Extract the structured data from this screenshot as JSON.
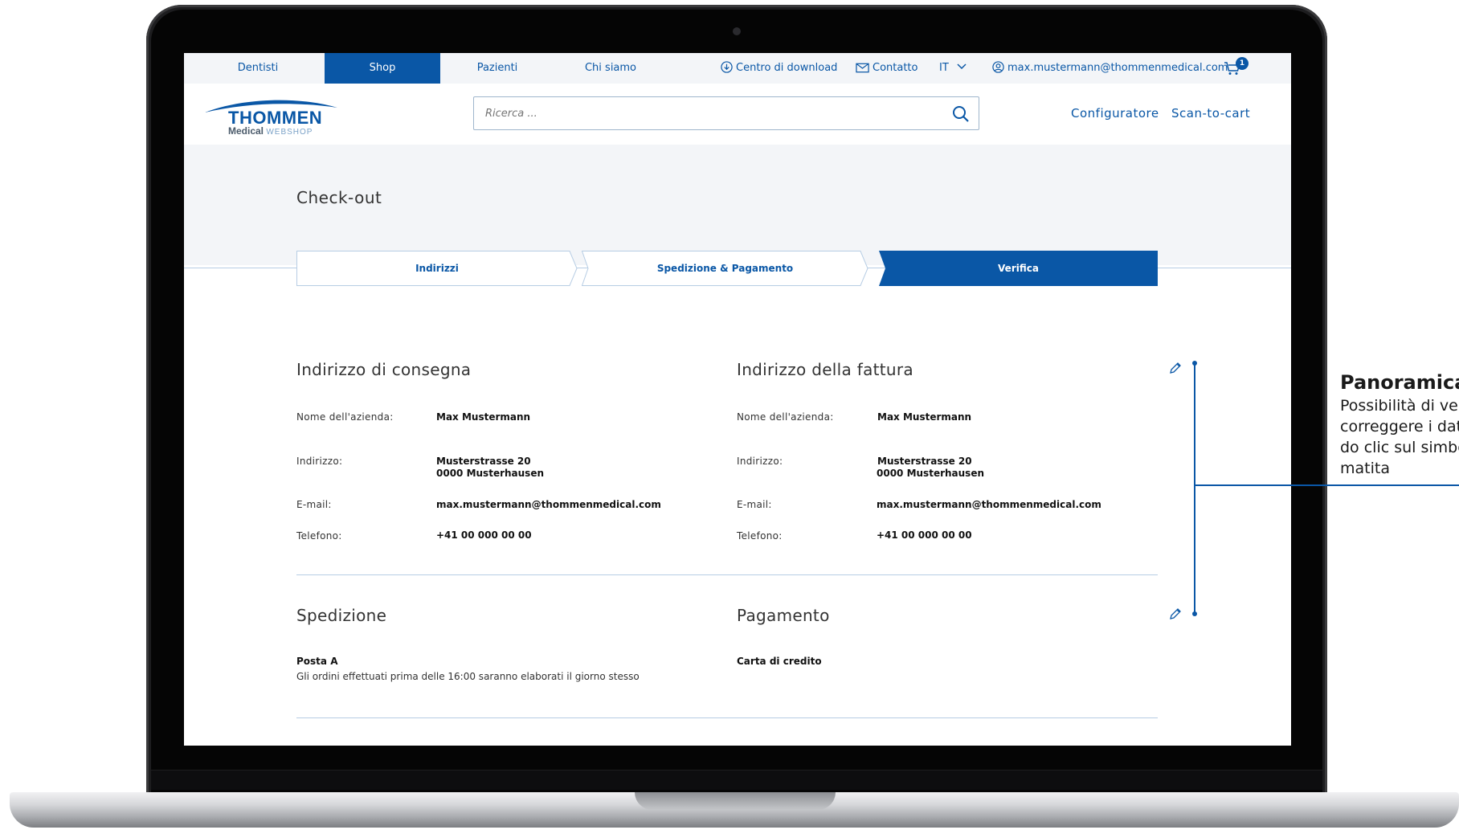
{
  "topnav": {
    "items": [
      {
        "label": "Dentisti",
        "active": false
      },
      {
        "label": "Shop",
        "active": true
      },
      {
        "label": "Pazienti",
        "active": false
      },
      {
        "label": "Chi siamo",
        "active": false
      }
    ],
    "download_label": "Centro di download",
    "contact_label": "Contatto",
    "language": "IT",
    "user_email": "max.mustermann@thommenmedical.com",
    "cart_count": "1"
  },
  "header": {
    "logo_main": "THOMMEN",
    "logo_sub_bold": "Medical",
    "logo_sub_light": "WEBSHOP",
    "search_placeholder": "Ricerca ...",
    "links": [
      "Configuratore",
      "Scan-to-cart"
    ]
  },
  "page": {
    "title": "Check-out"
  },
  "steps": [
    {
      "label": "Indirizzi",
      "active": false
    },
    {
      "label": "Spedizione & Pagamento",
      "active": false
    },
    {
      "label": "Verifica",
      "active": true
    }
  ],
  "delivery": {
    "title": "Indirizzo di consegna",
    "company_label": "Nome dell'azienda:",
    "company": "Max Mustermann",
    "address_label": "Indirizzo:",
    "street": "Musterstrasse 20",
    "city": "0000 Musterhausen",
    "email_label": "E-mail:",
    "email": "max.mustermann@thommenmedical.com",
    "phone_label": "Telefono:",
    "phone": "+41 00 000 00 00"
  },
  "billing": {
    "title": "Indirizzo della fattura",
    "company_label": "Nome dell'azienda:",
    "company": "Max Mustermann",
    "address_label": "Indirizzo:",
    "street": "Musterstrasse 20",
    "city": "0000 Musterhausen",
    "email_label": "E-mail:",
    "email": "max.mustermann@thommenmedical.com",
    "phone_label": "Telefono:",
    "phone": "+41 00 000 00 00"
  },
  "shipping": {
    "title": "Spedizione",
    "method": "Posta A",
    "note": "Gli ordini effettuati prima delle 16:00 saranno elaborati il giorno stesso"
  },
  "payment": {
    "title": "Pagamento",
    "method": "Carta di credito"
  },
  "annotation": {
    "title": "Panoramica",
    "lines": [
      "Possibilità di ve",
      "correggere i dat",
      "do clic sul simbo",
      "matita"
    ]
  },
  "colors": {
    "brand": "#0a57a6",
    "band": "#f3f5f8",
    "divider": "#b7cde4"
  },
  "icons": [
    "download-icon",
    "mail-icon",
    "chevron-down-icon",
    "user-icon",
    "cart-icon",
    "search-icon",
    "pencil-icon"
  ]
}
